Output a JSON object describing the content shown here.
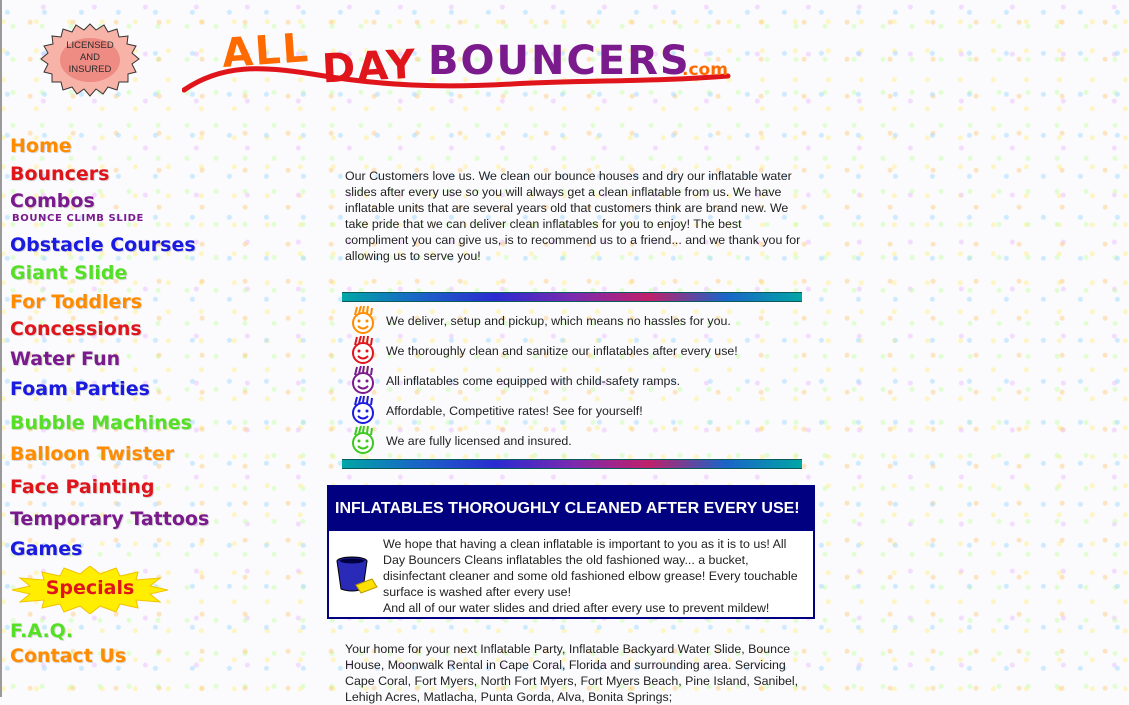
{
  "badge": {
    "text": "LICENSED\nAND\nINSURED"
  },
  "logo": {
    "words": [
      "ALL",
      "DAY",
      "BOUNCERS"
    ],
    "suffix": ".com"
  },
  "nav": [
    {
      "label": "Home",
      "color": "#ff8c00"
    },
    {
      "label": "Bouncers",
      "color": "#e0141b"
    },
    {
      "label": "Combos",
      "color": "#7a1a8c"
    },
    {
      "label": "Obstacle Courses",
      "color": "#1a1ae0"
    },
    {
      "label": "Giant Slide",
      "color": "#55e025"
    },
    {
      "label": "For Toddlers",
      "color": "#ff8c00"
    },
    {
      "label": "Concessions",
      "color": "#e0141b"
    },
    {
      "label": "Water Fun",
      "color": "#7a1a8c"
    },
    {
      "label": "Foam Parties",
      "color": "#1a1ae0"
    },
    {
      "label": "Bubble Machines",
      "color": "#55e025"
    },
    {
      "label": "Balloon Twister",
      "color": "#ff8c00"
    },
    {
      "label": "Face Painting",
      "color": "#e0141b"
    },
    {
      "label": "Temporary Tattoos",
      "color": "#7a1a8c"
    },
    {
      "label": "Games",
      "color": "#1a1ae0"
    },
    {
      "label": "F.A.Q.",
      "color": "#55e025"
    },
    {
      "label": "Contact Us",
      "color": "#ff8c00"
    }
  ],
  "nav_sub": "BOUNCE CLIMB SLIDE",
  "specials": "Specials",
  "intro": "Our Customers love us. We clean our bounce houses and dry our inflatable water slides after every use so you will always get a clean inflatable from us. We have inflatable units that are several years old that customers think are brand new. We take pride that we can deliver clean inflatables for you to enjoy! The best compliment you can give us, is to recommend us to a friend... and we thank you for allowing us to serve you!",
  "features": [
    {
      "text": "We deliver, setup and pickup, which means no hassles for you.",
      "icon": "smiley-icon",
      "color": "#ff8c00"
    },
    {
      "text": "We thoroughly clean and sanitize our inflatables after every use!",
      "icon": "smiley-icon",
      "color": "#e0141b"
    },
    {
      "text": "All inflatables come equipped with child-safety ramps.",
      "icon": "smiley-icon",
      "color": "#7a1a8c"
    },
    {
      "text": "Affordable, Competitive rates! See for yourself!",
      "icon": "smiley-icon",
      "color": "#1a1ae0"
    },
    {
      "text": "We are fully licensed and insured.",
      "icon": "smiley-icon",
      "color": "#3cc81e"
    }
  ],
  "clean_box": {
    "heading": "INFLATABLES THOROUGHLY CLEANED AFTER EVERY USE!",
    "para1": "We hope that having a clean inflatable is important to you as it is to us! All Day Bouncers Cleans inflatables the old fashioned way... a bucket, disinfectant cleaner and some old fashioned elbow grease! Every touchable surface is washed after every use!",
    "para2": "And all of our water slides and dried after every use to prevent mildew!"
  },
  "bottom_text": "Your home for your next Inflatable Party, Inflatable Backyard Water Slide, Bounce House, Moonwalk Rental in Cape Coral, Florida and surrounding area. Servicing Cape Coral, Fort Myers, North Fort Myers, Fort Myers Beach, Pine Island, Sanibel, Lehigh Acres, Matlacha, Punta Gorda, Alva, Bonita Springs;"
}
